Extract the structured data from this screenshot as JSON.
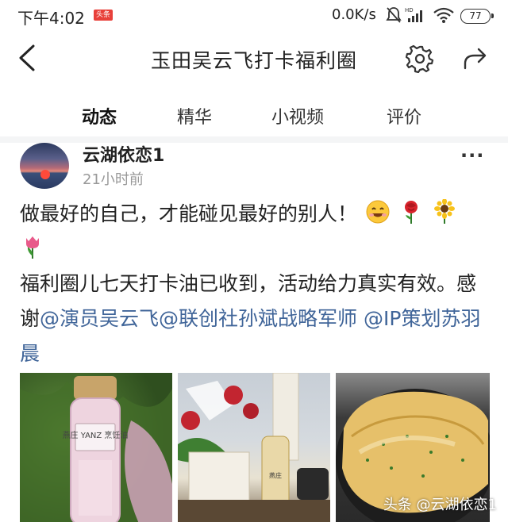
{
  "status_bar": {
    "time": "下午4:02",
    "app_badge": "头条",
    "network_speed": "0.0K/s",
    "battery": "77"
  },
  "header": {
    "title": "玉田吴云飞打卡福利圈"
  },
  "tabs": [
    {
      "label": "动态",
      "active": true
    },
    {
      "label": "精华",
      "active": false
    },
    {
      "label": "小视频",
      "active": false
    },
    {
      "label": "评价",
      "active": false
    }
  ],
  "post": {
    "author": "云湖依恋1",
    "time": "21小时前",
    "more_label": "···",
    "line1": "做最好的自己，才能碰见最好的别人！",
    "line3_prefix": "福利圈儿七天打卡油已收到，活动给力真实有效。感谢",
    "mentions": [
      "@演员吴云飞",
      "@联创社孙斌战略军师",
      "@IP策划苏羽晨"
    ],
    "emojis": [
      "smile-emoji",
      "rose-emoji",
      "sunflower-emoji",
      "tulip-emoji"
    ]
  },
  "images": [
    {
      "alt": "bottle-of-oil-photo",
      "label": "燕庄 YANZ 烹饪油"
    },
    {
      "alt": "flowers-and-oil-photo",
      "label": "燕庄"
    },
    {
      "alt": "pancake-photo",
      "label": ""
    }
  ],
  "watermark": "头条 @云湖依恋1",
  "colors": {
    "accent": "#f04142",
    "mention": "#406599",
    "muted": "#999999"
  }
}
